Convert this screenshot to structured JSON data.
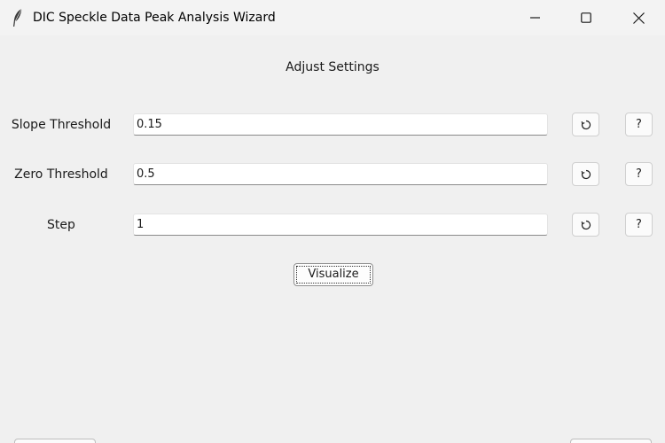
{
  "window": {
    "title": "DIC Speckle Data Peak Analysis Wizard",
    "app_icon": "feather-icon",
    "controls": [
      "minimize-icon",
      "maximize-icon",
      "close-icon"
    ]
  },
  "main": {
    "heading": "Adjust Settings",
    "rows": [
      {
        "label": "Slope Threshold",
        "value": "0.15",
        "reset_icon": "refresh-icon",
        "help_label": "?"
      },
      {
        "label": "Zero Threshold",
        "value": "0.5",
        "reset_icon": "refresh-icon",
        "help_label": "?"
      },
      {
        "label": "Step",
        "value": "1",
        "reset_icon": "refresh-icon",
        "help_label": "?"
      }
    ],
    "visualize_label": "Visualize"
  },
  "colors": {
    "background": "#f0f0f0",
    "field_background": "#ffffff",
    "text": "#1a1a1a"
  }
}
